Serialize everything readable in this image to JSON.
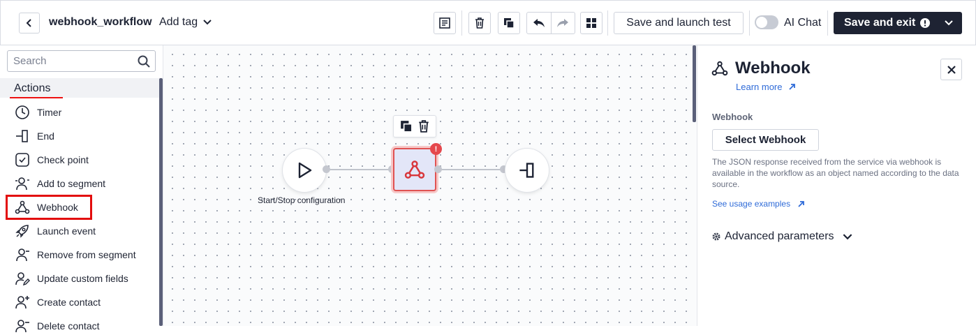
{
  "header": {
    "workflow_name": "webhook_workflow",
    "add_tag_label": "Add tag",
    "save_launch_label": "Save and launch test",
    "ai_chat_label": "AI Chat",
    "save_exit_label": "Save and exit",
    "ai_chat_enabled": false
  },
  "sidebar": {
    "search_placeholder": "Search",
    "section_title": "Actions",
    "items": [
      {
        "label": "Timer",
        "icon": "clock-icon"
      },
      {
        "label": "End",
        "icon": "end-icon"
      },
      {
        "label": "Check point",
        "icon": "checkbox-icon"
      },
      {
        "label": "Add to segment",
        "icon": "user-add-icon"
      },
      {
        "label": "Webhook",
        "icon": "webhook-icon"
      },
      {
        "label": "Launch event",
        "icon": "rocket-icon"
      },
      {
        "label": "Remove from segment",
        "icon": "user-remove-icon"
      },
      {
        "label": "Update custom fields",
        "icon": "user-edit-icon"
      },
      {
        "label": "Create contact",
        "icon": "user-plus-icon"
      },
      {
        "label": "Delete contact",
        "icon": "user-delete-icon"
      }
    ]
  },
  "canvas": {
    "start_label": "Start/Stop configuration",
    "error_badge": "!"
  },
  "panel": {
    "title": "Webhook",
    "learn_more": "Learn more",
    "field_label": "Webhook",
    "select_button": "Select Webhook",
    "description": "The JSON response received from the service via webhook is available in the workflow as an object named according to the data source.",
    "usage_link": "See usage examples",
    "advanced_label": "Advanced parameters"
  },
  "colors": {
    "accent_dark": "#1e2333",
    "link_blue": "#2f6bd8",
    "error_red": "#e5484d",
    "highlight_red": "#e30d0d"
  }
}
